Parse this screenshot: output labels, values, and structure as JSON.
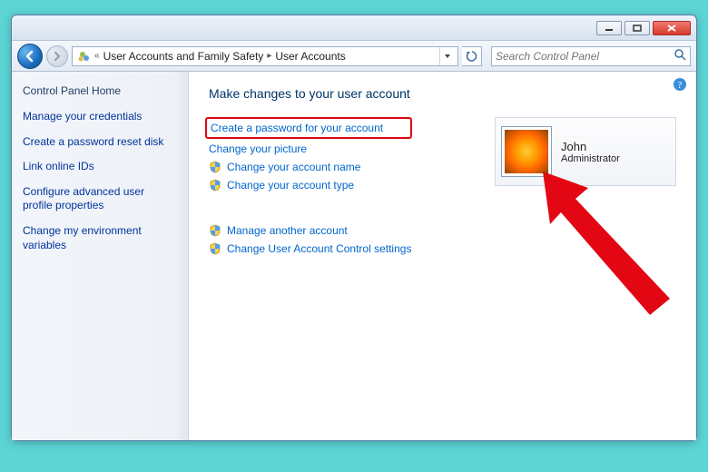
{
  "window": {
    "minimize_label": "Minimize",
    "maximize_label": "Maximize",
    "close_label": "Close"
  },
  "nav": {
    "back_label": "Back",
    "forward_label": "Forward",
    "breadcrumb": {
      "prefix_glyph": "«",
      "segment1": "User Accounts and Family Safety",
      "segment2": "User Accounts"
    },
    "refresh_label": "Refresh",
    "search_placeholder": "Search Control Panel"
  },
  "sidebar": {
    "heading": "Control Panel Home",
    "items": [
      {
        "label": "Manage your credentials"
      },
      {
        "label": "Create a password reset disk"
      },
      {
        "label": "Link online IDs"
      },
      {
        "label": "Configure advanced user profile properties"
      },
      {
        "label": "Change my environment variables"
      }
    ]
  },
  "main": {
    "heading": "Make changes to your user account",
    "group1": [
      {
        "label": "Create a password for your account",
        "shield": false,
        "highlight": true
      },
      {
        "label": "Change your picture",
        "shield": false,
        "highlight": false
      },
      {
        "label": "Change your account name",
        "shield": true,
        "highlight": false
      },
      {
        "label": "Change your account type",
        "shield": true,
        "highlight": false
      }
    ],
    "group2": [
      {
        "label": "Manage another account",
        "shield": true
      },
      {
        "label": "Change User Account Control settings",
        "shield": true
      }
    ]
  },
  "user": {
    "name": "John",
    "role": "Administrator"
  },
  "help_label": "Help"
}
